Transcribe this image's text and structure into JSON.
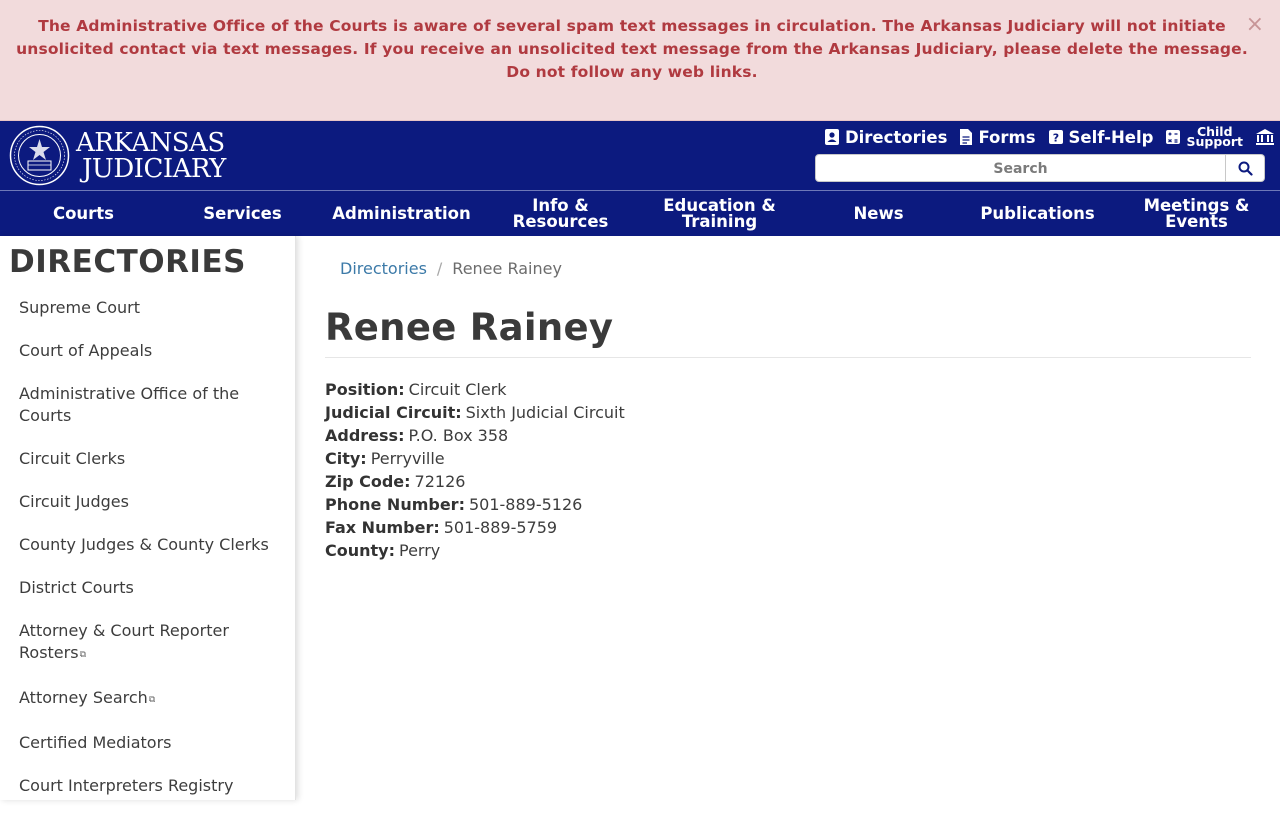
{
  "alert": {
    "message": "The Administrative Office of the Courts is aware of several spam text messages in circulation.  The Arkansas Judiciary will not initiate unsolicited contact via text messages. If you receive an unsolicited text message from the Arkansas Judiciary, please delete the message. Do not follow any web links.",
    "close_label": "×"
  },
  "header": {
    "logo_line1": "ARKANSAS",
    "logo_line2": "JUDICIARY",
    "utility_nav": {
      "directories": "Directories",
      "forms": "Forms",
      "self_help": "Self-Help",
      "child": "Child",
      "support": "Support"
    },
    "search_placeholder": "Search"
  },
  "main_nav": [
    {
      "line1": "Courts",
      "line2": ""
    },
    {
      "line1": "Services",
      "line2": ""
    },
    {
      "line1": "Administration",
      "line2": ""
    },
    {
      "line1": "Info &",
      "line2": "Resources"
    },
    {
      "line1": "Education &",
      "line2": "Training"
    },
    {
      "line1": "News",
      "line2": ""
    },
    {
      "line1": "Publications",
      "line2": ""
    },
    {
      "line1": "Meetings &",
      "line2": "Events"
    }
  ],
  "sidebar": {
    "title": "DIRECTORIES",
    "items": [
      {
        "label": "Supreme Court"
      },
      {
        "label": "Court of Appeals"
      },
      {
        "label": "Administrative Office of the Courts"
      },
      {
        "label": "Circuit Clerks"
      },
      {
        "label": "Circuit Judges"
      },
      {
        "label": "County Judges & County Clerks"
      },
      {
        "label": "District Courts"
      },
      {
        "label": "Attorney & Court Reporter Rosters",
        "external": true
      },
      {
        "label": "Attorney Search",
        "external": true
      },
      {
        "label": "Certified Mediators"
      },
      {
        "label": "Court Interpreters Registry"
      }
    ]
  },
  "breadcrumb": {
    "parent": "Directories",
    "separator": "/",
    "current": "Renee Rainey"
  },
  "page_title": "Renee Rainey",
  "details": [
    {
      "label": "Position:",
      "value": "Circuit Clerk"
    },
    {
      "label": "Judicial Circuit:",
      "value": "Sixth Judicial Circuit"
    },
    {
      "label": "Address:",
      "value": "P.O. Box 358"
    },
    {
      "label": "City:",
      "value": "Perryville"
    },
    {
      "label": "Zip Code:",
      "value": "72126"
    },
    {
      "label": "Phone Number:",
      "value": "501-889-5126"
    },
    {
      "label": "Fax Number:",
      "value": "501-889-5759"
    },
    {
      "label": "County:",
      "value": "Perry"
    }
  ],
  "colors": {
    "header_bg": "#0c1a7f",
    "alert_bg": "#f2dbdc",
    "alert_text": "#b03a40",
    "link": "#3c7aa8"
  },
  "icons": {
    "directories": "contact-card-icon",
    "forms": "document-icon",
    "self_help": "question-icon",
    "child_support": "calculator-icon",
    "overflow": "courthouse-icon",
    "search": "magnifier-icon",
    "external": "external-link-icon"
  }
}
